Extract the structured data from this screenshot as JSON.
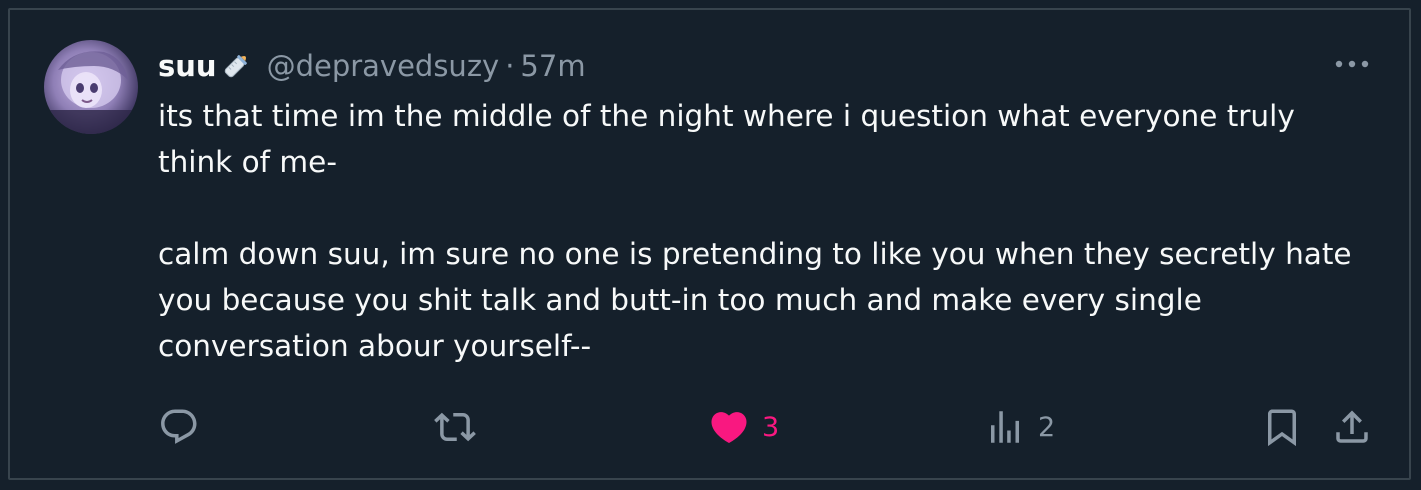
{
  "post": {
    "display_name": "suu",
    "name_emoji": "baby-bottle-emoji",
    "handle": "@depravedsuzy",
    "separator": "·",
    "time": "57m",
    "text": [
      "its that time im the middle of the night where i question what everyone truly think of me-",
      "calm down suu, im sure no one is pretending to like you when they secretly hate you because you shit talk and butt-in too much and make every single conversation abour yourself--"
    ]
  },
  "actions": {
    "reply": {
      "icon": "reply-icon",
      "count": ""
    },
    "repost": {
      "icon": "repost-icon",
      "count": ""
    },
    "like": {
      "icon": "heart-icon",
      "count": "3",
      "liked": true,
      "color": "#f91880"
    },
    "views": {
      "icon": "views-icon",
      "count": "2"
    },
    "bookmark": {
      "icon": "bookmark-icon"
    },
    "share": {
      "icon": "share-icon"
    }
  },
  "colors": {
    "background": "#15202b",
    "border": "#38444d",
    "primary_text": "#f7f9f9",
    "secondary_text": "#8b98a5",
    "like": "#f91880"
  }
}
